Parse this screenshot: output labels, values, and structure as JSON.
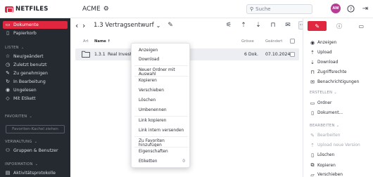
{
  "app": {
    "logo_text": "NETFILES",
    "org_name": "ACME",
    "search_placeholder": "Suche",
    "avatar_initials": "AW",
    "accent_color": "#e1273f"
  },
  "sidebar": {
    "items": [
      {
        "label": "Dokumente",
        "icon": "folder-icon"
      },
      {
        "label": "Papierkorb",
        "icon": "trash-icon"
      }
    ],
    "section_lists": "LISTEN",
    "lists": [
      {
        "label": "Neu/geändert",
        "icon": "star-icon"
      },
      {
        "label": "Zuletzt benutzt",
        "icon": "clock-icon"
      },
      {
        "label": "Zu genehmigen",
        "icon": "pencil-icon"
      },
      {
        "label": "In Bearbeitung",
        "icon": "sync-icon"
      },
      {
        "label": "Ungelesen",
        "icon": "eye-icon"
      },
      {
        "label": "Mit Etikett",
        "icon": "tag-icon"
      }
    ],
    "section_favorites": "FAVORITEN",
    "favorites_button": "Favoriten-Kachel ziehen",
    "section_admin": "VERWALTUNG",
    "admin": [
      {
        "label": "Gruppen & Benutzer",
        "icon": "users-icon"
      }
    ],
    "section_info": "INFORMATION",
    "info": [
      {
        "label": "Aktivitätsprotokolle",
        "icon": "log-icon"
      }
    ]
  },
  "toolbar": {
    "breadcrumb": "1.3 Vertragsentwurf"
  },
  "table": {
    "col_type": "Art",
    "col_name": "Name",
    "col_size": "Grösse",
    "col_changed": "Geändert",
    "rows": [
      {
        "number": "1.3.1",
        "name": "Real Invest",
        "size": "6 Dok.",
        "changed": "07.10.2024"
      }
    ]
  },
  "context_menu": {
    "items": [
      "Anzeigen",
      "Download",
      "Neuer Ordner mit Auswahl",
      "Kopieren",
      "Verschieben",
      "Löschen",
      "Umbenennen",
      "Link kopieren",
      "Link intern versenden",
      "Zu Favoriten hinzufügen",
      "Eigenschaften",
      "Etiketten"
    ],
    "etiketten_count": "0"
  },
  "right_panel": {
    "actions": [
      {
        "label": "Anzeigen",
        "icon": "eye-icon",
        "disabled": false
      },
      {
        "label": "Upload",
        "icon": "upload-icon",
        "disabled": false
      },
      {
        "label": "Download",
        "icon": "download-icon",
        "disabled": false
      },
      {
        "label": "Zugriffsrechte",
        "icon": "lock-icon",
        "disabled": false
      },
      {
        "label": "Benachrichtigungen",
        "icon": "mail-icon",
        "disabled": false
      }
    ],
    "section_create": "ERSTELLEN",
    "create": [
      {
        "label": "Ordner",
        "icon": "folder-plus-icon"
      },
      {
        "label": "Dokument...",
        "icon": "file-plus-icon"
      }
    ],
    "section_edit": "BEARBEITEN",
    "edit": [
      {
        "label": "Bearbeiten",
        "icon": "pencil-icon",
        "disabled": true
      },
      {
        "label": "Upload neue Version",
        "icon": "upload-icon",
        "disabled": true
      },
      {
        "label": "Löschen",
        "icon": "trash-icon",
        "disabled": false
      },
      {
        "label": "Kopieren",
        "icon": "copy-icon",
        "disabled": false
      },
      {
        "label": "Verschieben",
        "icon": "move-icon",
        "disabled": false
      }
    ]
  }
}
